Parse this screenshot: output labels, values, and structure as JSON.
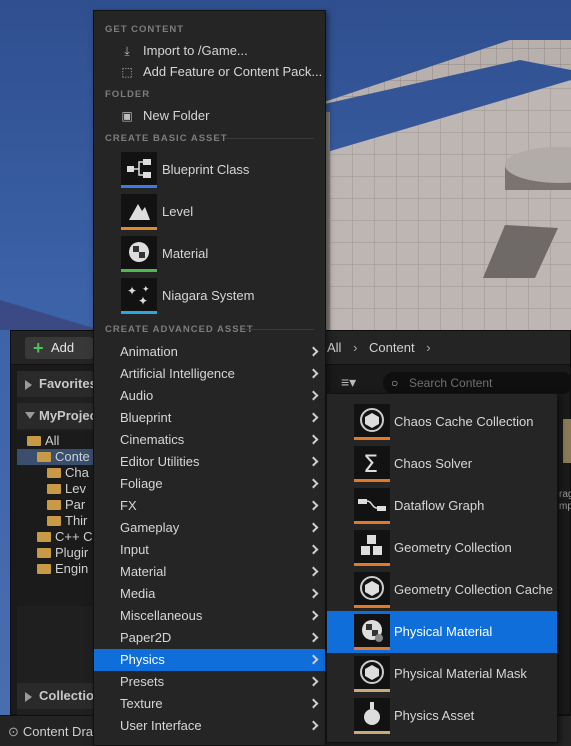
{
  "content_browser": {
    "add_label": "Add",
    "favorites_label": "Favorites",
    "project_label": "MyProjec",
    "collections_label": "Collection",
    "tree": [
      {
        "label": "All"
      },
      {
        "label": "Conte"
      },
      {
        "label": "Cha"
      },
      {
        "label": "Lev"
      },
      {
        "label": "Par"
      },
      {
        "label": "Thir"
      },
      {
        "label": "C++ C"
      },
      {
        "label": "Plugir"
      },
      {
        "label": "Engin"
      }
    ],
    "path": [
      "All",
      "Content"
    ],
    "search_placeholder": "Search Content",
    "side_text": [
      "rag",
      "mp"
    ]
  },
  "bottom_bar": {
    "content_drawer_label": "Content Dra"
  },
  "menu": {
    "sections": {
      "get_content": "GET CONTENT",
      "folder": "FOLDER",
      "create_basic": "CREATE BASIC ASSET",
      "create_advanced": "CREATE ADVANCED ASSET"
    },
    "get_content_items": [
      "Import to /Game...",
      "Add Feature or Content Pack..."
    ],
    "folder_items": [
      "New Folder"
    ],
    "basic_assets": [
      "Blueprint Class",
      "Level",
      "Material",
      "Niagara System"
    ],
    "advanced_assets": [
      "Animation",
      "Artificial Intelligence",
      "Audio",
      "Blueprint",
      "Cinematics",
      "Editor Utilities",
      "Foliage",
      "FX",
      "Gameplay",
      "Input",
      "Material",
      "Media",
      "Miscellaneous",
      "Paper2D",
      "Physics",
      "Presets",
      "Texture",
      "User Interface"
    ],
    "selected_advanced": "Physics"
  },
  "submenu": {
    "items": [
      "Chaos Cache Collection",
      "Chaos Solver",
      "Dataflow Graph",
      "Geometry Collection",
      "Geometry Collection Cache",
      "Physical Material",
      "Physical Material Mask",
      "Physics Asset"
    ],
    "selected": "Physical Material"
  },
  "colors": {
    "selection": "#0f6ed9",
    "accent_blueprint": "#3b7be8",
    "accent_level": "#e08a2a",
    "accent_material": "#4fb84f",
    "accent_niagara": "#2aa6e0",
    "accent_physics": "#e07a2a"
  }
}
